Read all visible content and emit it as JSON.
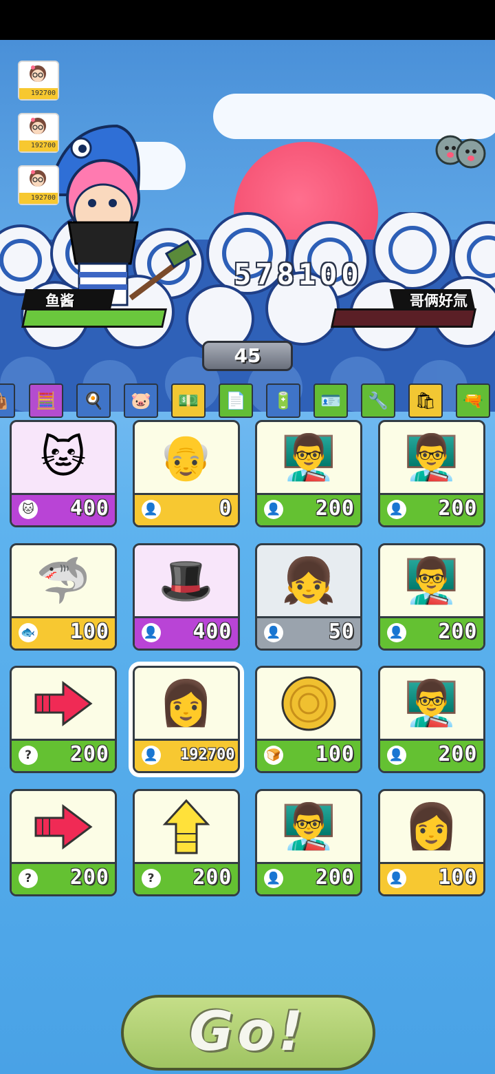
{
  "player": {
    "name": "鱼酱",
    "hp_fraction": 1.0,
    "hp_color": "#6ac73d"
  },
  "opponent": {
    "name": "哥俩好氚",
    "hp_fraction": 0.0,
    "hp_color": "#6c2a30"
  },
  "score": "578100",
  "round": "45",
  "team_queue": [
    {
      "icon": "girl-glasses-avatar-icon",
      "value": "192700"
    },
    {
      "icon": "girl-glasses-avatar-icon",
      "value": "192700"
    },
    {
      "icon": "girl-glasses-avatar-icon",
      "value": "192700"
    }
  ],
  "shop_items": [
    {
      "icon": "bag-icon",
      "color": "#3f74c8"
    },
    {
      "icon": "calculator-icon",
      "color": "#b44ccf"
    },
    {
      "icon": "frying-pan-icon",
      "color": "#3f74c8"
    },
    {
      "icon": "piggy-bank-icon",
      "color": "#3f74c8"
    },
    {
      "icon": "cash-stack-icon",
      "color": "#f2c733"
    },
    {
      "icon": "document-icon",
      "color": "#63bd35"
    },
    {
      "icon": "battery-icon",
      "color": "#3f74c8"
    },
    {
      "icon": "id-card-icon",
      "color": "#63bd35"
    },
    {
      "icon": "tools-icon",
      "color": "#63bd35"
    },
    {
      "icon": "gift-bag-icon",
      "color": "#f2c733"
    },
    {
      "icon": "gun-icon",
      "color": "#63bd35"
    }
  ],
  "cards": [
    {
      "art": "cat-icon",
      "emoji": "🐱",
      "bar_icon": "cat-face-icon",
      "bar_glyph": "🐱",
      "value": "400",
      "bar": "purple",
      "bg": "pink"
    },
    {
      "art": "old-scientist-icon",
      "emoji": "👴",
      "bar_icon": "person-icon",
      "bar_glyph": "👤",
      "value": "0",
      "bar": "yellow",
      "bg": ""
    },
    {
      "art": "teacher-icon",
      "emoji": "👨‍🏫",
      "bar_icon": "person-icon",
      "bar_glyph": "👤",
      "value": "200",
      "bar": "green",
      "bg": ""
    },
    {
      "art": "teacher-icon",
      "emoji": "👨‍🏫",
      "bar_icon": "person-icon",
      "bar_glyph": "👤",
      "value": "200",
      "bar": "green",
      "bg": ""
    },
    {
      "art": "shark-icon",
      "emoji": "🦈",
      "bar_icon": "fish-icon",
      "bar_glyph": "🐟",
      "value": "100",
      "bar": "yellow",
      "bg": ""
    },
    {
      "art": "top-hat-gentleman-icon",
      "emoji": "🎩",
      "bar_icon": "person-icon",
      "bar_glyph": "👤",
      "value": "400",
      "bar": "purple",
      "bg": "pink"
    },
    {
      "art": "girl-icon",
      "emoji": "👧",
      "bar_icon": "person-icon",
      "bar_glyph": "👤",
      "value": "50",
      "bar": "gray",
      "bg": "gray"
    },
    {
      "art": "teacher-icon",
      "emoji": "👨‍🏫",
      "bar_icon": "person-icon",
      "bar_glyph": "👤",
      "value": "200",
      "bar": "green",
      "bg": ""
    },
    {
      "art": "red-arrow-right-icon",
      "emoji": "➡",
      "bar_icon": "question-icon",
      "bar_glyph": "?",
      "value": "200",
      "bar": "green",
      "bg": ""
    },
    {
      "art": "girl-glasses-icon",
      "emoji": "👩",
      "bar_icon": "person-icon",
      "bar_glyph": "👤",
      "value": "192700",
      "bar": "yellow",
      "bg": "",
      "selected": true
    },
    {
      "art": "pancake-icon",
      "emoji": "🥞",
      "bar_icon": "bread-icon",
      "bar_glyph": "🍞",
      "value": "100",
      "bar": "green",
      "bg": ""
    },
    {
      "art": "teacher-icon",
      "emoji": "👨‍🏫",
      "bar_icon": "person-icon",
      "bar_glyph": "👤",
      "value": "200",
      "bar": "green",
      "bg": ""
    },
    {
      "art": "red-arrow-right-icon",
      "emoji": "➡",
      "bar_icon": "question-icon",
      "bar_glyph": "?",
      "value": "200",
      "bar": "green",
      "bg": ""
    },
    {
      "art": "yellow-arrow-up-icon",
      "emoji": "⬆",
      "bar_icon": "question-icon",
      "bar_glyph": "?",
      "value": "200",
      "bar": "green",
      "bg": ""
    },
    {
      "art": "teacher-icon",
      "emoji": "👨‍🏫",
      "bar_icon": "person-icon",
      "bar_glyph": "👤",
      "value": "200",
      "bar": "green",
      "bg": ""
    },
    {
      "art": "girl-glasses-icon",
      "emoji": "👩",
      "bar_icon": "person-icon",
      "bar_glyph": "👤",
      "value": "100",
      "bar": "yellow",
      "bg": ""
    }
  ],
  "go_button": {
    "label": "Go!"
  }
}
